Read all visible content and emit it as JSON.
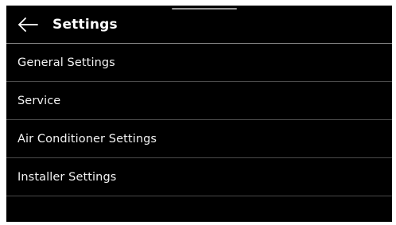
{
  "header": {
    "title": "Settings",
    "back_icon": "arrow-left-icon"
  },
  "menu": {
    "items": [
      {
        "label": "General Settings"
      },
      {
        "label": "Service"
      },
      {
        "label": "Air Conditioner Settings"
      },
      {
        "label": "Installer Settings"
      }
    ]
  },
  "colors": {
    "background": "#000000",
    "text": "#ffffff",
    "divider": "#4a4a4a",
    "header_divider": "#8a8a8a",
    "bezel": "#ffffff"
  }
}
